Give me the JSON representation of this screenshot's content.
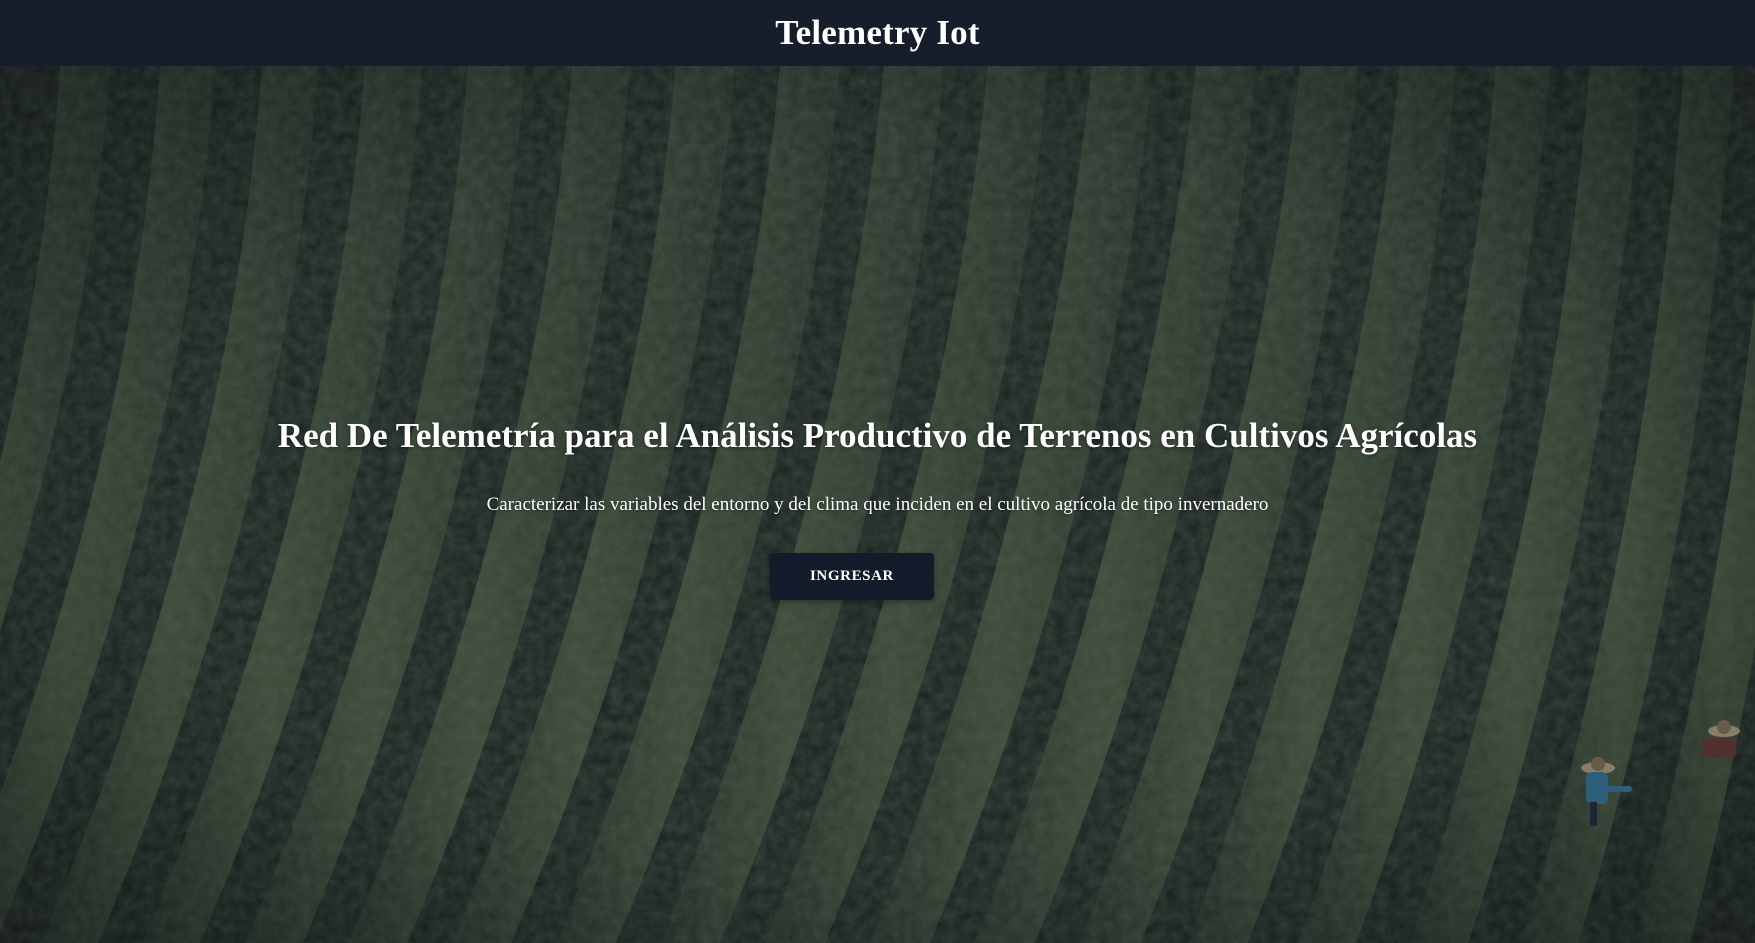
{
  "navbar": {
    "brand": "Telemetry Iot"
  },
  "hero": {
    "title": "Red De Telemetría para el Análisis Productivo de Terrenos en Cultivos Agrícolas",
    "subtitle": "Caracterizar las variables del entorno y del clima que inciden en el cultivo agrícola de tipo invernadero",
    "cta_label": "INGRESAR",
    "background_image": "aerial-tea-field-photo"
  },
  "colors": {
    "navbar_bg": "#161e2b",
    "cta_bg": "#131a2a",
    "text": "#ffffff",
    "field_dark": "#2c3a2e",
    "field_light": "#4c5e3f"
  }
}
